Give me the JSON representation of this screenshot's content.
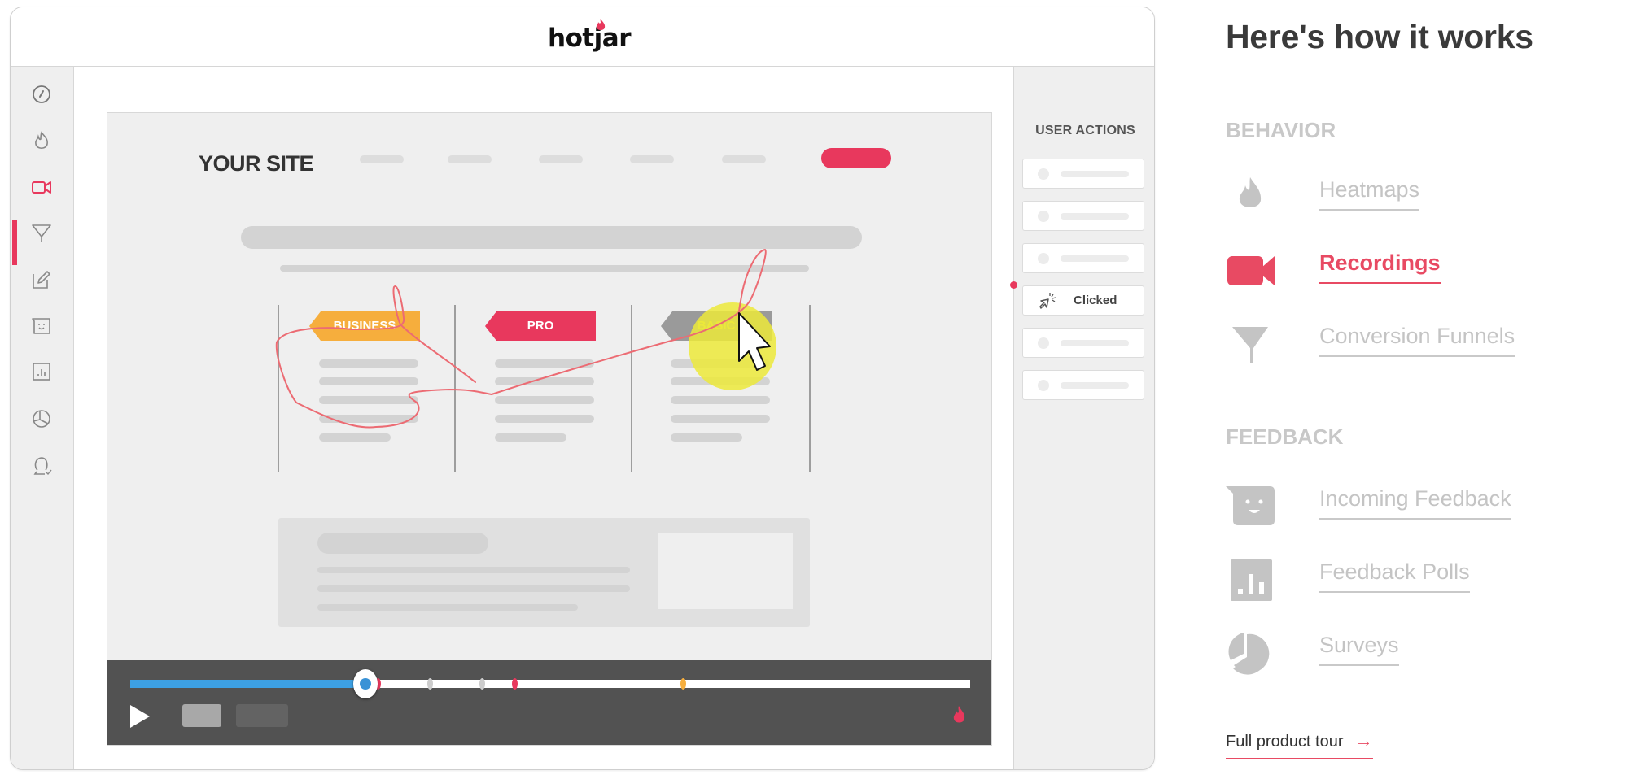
{
  "app": {
    "logo": "hotjar",
    "brand_color": "#e8385d"
  },
  "sidebar": {
    "items": [
      {
        "name": "dashboard-icon",
        "active": false
      },
      {
        "name": "heatmap-icon",
        "active": false
      },
      {
        "name": "recordings-icon",
        "active": true
      },
      {
        "name": "funnel-icon",
        "active": false
      },
      {
        "name": "forms-icon",
        "active": false
      },
      {
        "name": "feedback-icon",
        "active": false
      },
      {
        "name": "polls-icon",
        "active": false
      },
      {
        "name": "surveys-icon",
        "active": false
      },
      {
        "name": "recruiters-icon",
        "active": false
      }
    ]
  },
  "site": {
    "title": "YOUR SITE",
    "plans": [
      {
        "label": "BUSINESS",
        "color": "#f6ae3d"
      },
      {
        "label": "PRO",
        "color": "#e8385d"
      },
      {
        "label": "BASIC",
        "color": "#9a9a9a"
      }
    ]
  },
  "player": {
    "progress_percent": 28,
    "markers": [
      {
        "position_percent": 29.5,
        "color": "#e8385d"
      },
      {
        "position_percent": 35.7,
        "color": "#cccccc"
      },
      {
        "position_percent": 41.9,
        "color": "#cccccc"
      },
      {
        "position_percent": 45.7,
        "color": "#e8385d"
      },
      {
        "position_percent": 65.8,
        "color": "#f6ae3d"
      }
    ]
  },
  "user_actions": {
    "title": "USER ACTIONS",
    "items": [
      {
        "label": "",
        "placeholder": true
      },
      {
        "label": "",
        "placeholder": true
      },
      {
        "label": "",
        "placeholder": true
      },
      {
        "label": "Clicked",
        "placeholder": false
      },
      {
        "label": "",
        "placeholder": true
      },
      {
        "label": "",
        "placeholder": true
      }
    ]
  },
  "info": {
    "title": "Here's how it works",
    "sections": [
      {
        "heading": "BEHAVIOR",
        "features": [
          {
            "label": "Heatmaps",
            "icon": "flame-icon",
            "active": false
          },
          {
            "label": "Recordings",
            "icon": "video-camera-icon",
            "active": true
          },
          {
            "label": "Conversion Funnels",
            "icon": "funnel-icon",
            "active": false
          }
        ]
      },
      {
        "heading": "FEEDBACK",
        "features": [
          {
            "label": "Incoming Feedback",
            "icon": "smiley-chat-icon",
            "active": false
          },
          {
            "label": "Feedback Polls",
            "icon": "bar-chart-icon",
            "active": false
          },
          {
            "label": "Surveys",
            "icon": "pie-chart-icon",
            "active": false
          }
        ]
      }
    ],
    "tour_link": "Full product tour",
    "tour_arrow": "→"
  }
}
